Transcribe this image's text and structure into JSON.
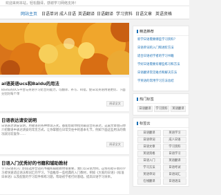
{
  "topbar": {
    "message": "欢迎来到本站，轻松翻译，感谢学习网络支持！"
  },
  "nav": {
    "items": [
      {
        "label": "网站主页",
        "active": true
      },
      {
        "label": "日语单词",
        "active": false
      },
      {
        "label": "成人日语",
        "active": false
      },
      {
        "label": "英语翻译",
        "active": false
      },
      {
        "label": "日语翻译",
        "active": false
      },
      {
        "label": "学习资料",
        "active": false
      },
      {
        "label": "日语文章",
        "active": false
      },
      {
        "label": "英语资格",
        "active": false
      }
    ]
  },
  "articles": [
    {
      "title": "ai语英语ucs和Baidu的用法",
      "text": "Baidu的UCS平台与英语学习结合的能力，可翻译、补写、纠错，使日常英语用语更优、下面分别对每个单",
      "more": "阅读全文"
    },
    {
      "title": "日语表达请安说明",
      "text": "日语表达请安说明，用敬语的各种体现方式，都能帮助你找到最适合的表达，这篇文章会向你介绍敬语中表达请安的常见方式，让你掌握在日常交往中的基本礼节，例如下面这些用法的情况就比较复杂……",
      "more": "阅读全文"
    },
    {
      "title": "日语入门优秀好的书籍和辅助教材",
      "text": "学习日语的入门阶段选择合适的书籍和辅助教材很重要，我们以日语为例，这样有助于新的学习者快速适应语法和词汇的学习，下面推荐一些经典的入门教材，例如《大家的日语》《标准日本语》以及配套的学习软件和练习题，帮助初学者打好基础，提高日语学习效率。",
      "more": "阅读全文"
    }
  ],
  "sidebar": {
    "recommend": {
      "title": "精选推荐",
      "links": [
        "新学日语需要哪些学习资料？",
        "日语单词的入门和进阶方法",
        "适合日语初学者的学习书籍",
        "学好日语需要有哪些练习和方法",
        "日语翻译常见难点和解决方法",
        "学英语的常用学习方法总结"
      ]
    },
    "hot": {
      "title": "热门标签",
      "tags": [
        "日语翻译",
        "学习资料",
        "英语翻译"
      ]
    },
    "tagcloud": {
      "title": "标签云",
      "tags": [
        "日语翻译",
        "英语学习",
        "日语单词",
        "成人日语",
        "日语文章",
        "学习资料",
        "英语资格",
        "日语学习",
        "日语入门",
        "英语翻译",
        "学习方法",
        "日语考试",
        "英语单词",
        "日语词汇",
        "在线翻译",
        "日语语法"
      ]
    }
  }
}
